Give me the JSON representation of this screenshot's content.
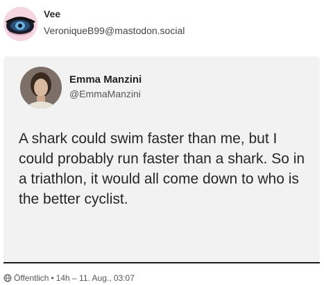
{
  "post": {
    "display_name": "Vee",
    "handle": "VeroniqueB99@mastodon.social"
  },
  "tweet": {
    "display_name": "Emma Manzini",
    "handle": "@EmmaManzini",
    "text": "A shark could swim faster than me, but I could probably run faster than a shark. So in a triathlon, it would all come down to who is the better cyclist."
  },
  "footer": {
    "icon": "globe-icon",
    "visibility": "Öffentlich",
    "separator": "•",
    "time_info": "14h – 11. Aug., 03:07"
  },
  "colors": {
    "avatar_bg": "#f3d2dc",
    "embed_bg": "#f2f2f2"
  }
}
